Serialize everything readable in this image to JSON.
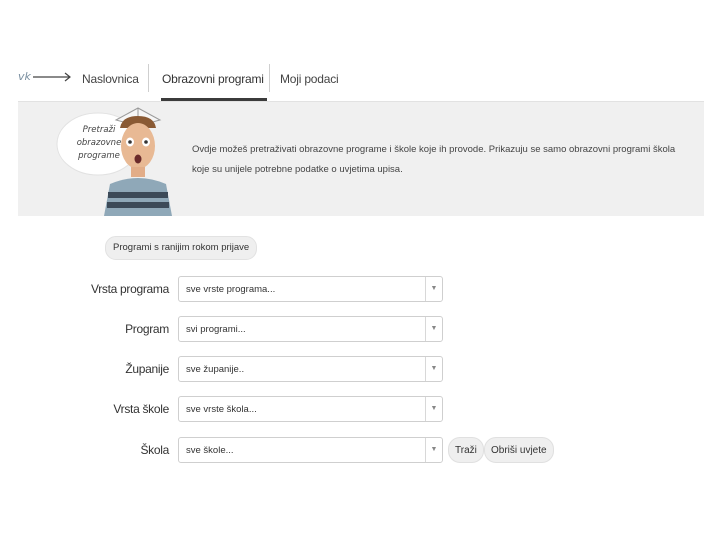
{
  "nav": {
    "logo_icon": "arrow-logo-icon",
    "items": [
      {
        "label": "Naslovnica",
        "active": false
      },
      {
        "label": "Obrazovni programi",
        "active": true
      },
      {
        "label": "Moji podaci",
        "active": false
      }
    ]
  },
  "banner": {
    "bubble_lines": [
      "Pretraži",
      "obrazovne",
      "programe"
    ],
    "text": "Ovdje možeš pretraživati obrazovne programe i škole koje ih provode. Prikazuju se samo obrazovni programi škola koje su unijele potrebne podatke o uvjetima upisa.",
    "illustration_icon": "student-with-book-illustration"
  },
  "filters": {
    "early_registration_label": "Programi s ranijim rokom prijave",
    "rows": [
      {
        "label": "Vrsta programa",
        "value": "sve vrste programa..."
      },
      {
        "label": "Program",
        "value": "svi programi..."
      },
      {
        "label": "Županije",
        "value": "sve županije.."
      },
      {
        "label": "Vrsta škole",
        "value": "sve vrste škola..."
      },
      {
        "label": "Škola",
        "value": "sve škole..."
      }
    ],
    "search_label": "Traži",
    "clear_label": "Obriši uvjete",
    "dropdown_icon": "triangle-down-icon"
  },
  "colors": {
    "banner_bg": "#f0f0f0",
    "active_indicator": "#3b3b3b",
    "button_bg": "#efefef"
  }
}
